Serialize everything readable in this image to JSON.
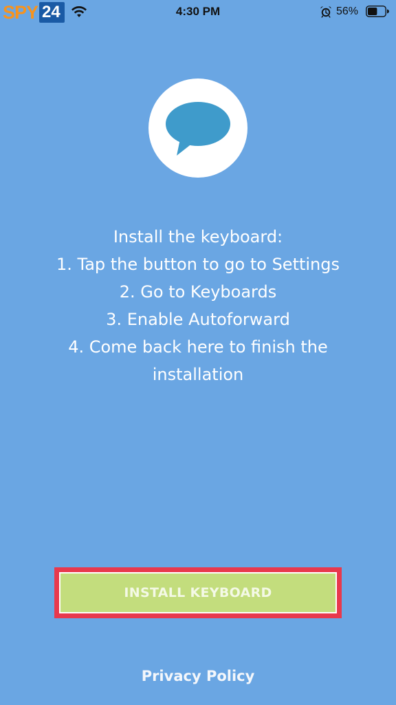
{
  "status_bar": {
    "time": "4:30 PM",
    "battery_percent": "56%",
    "battery_level": 0.56,
    "icons": [
      "wifi-icon",
      "alarm-icon",
      "battery-icon"
    ]
  },
  "watermark": {
    "brand_text": "SPY",
    "brand_number": "24"
  },
  "logo": {
    "icon": "chat-bubble-icon",
    "bubble_color": "#3f9bcb"
  },
  "instructions": {
    "heading": "Install the keyboard:",
    "steps": [
      "1. Tap the button to go to Settings",
      "2. Go to Keyboards",
      "3. Enable Autoforward",
      "4. Come back here to finish the",
      "installation"
    ]
  },
  "install_button": {
    "label": "INSTALL KEYBOARD",
    "color": "#c3dd7d",
    "highlight_color": "#e8394d"
  },
  "footer": {
    "privacy_label": "Privacy Policy"
  },
  "colors": {
    "background": "#6aa6e3"
  }
}
